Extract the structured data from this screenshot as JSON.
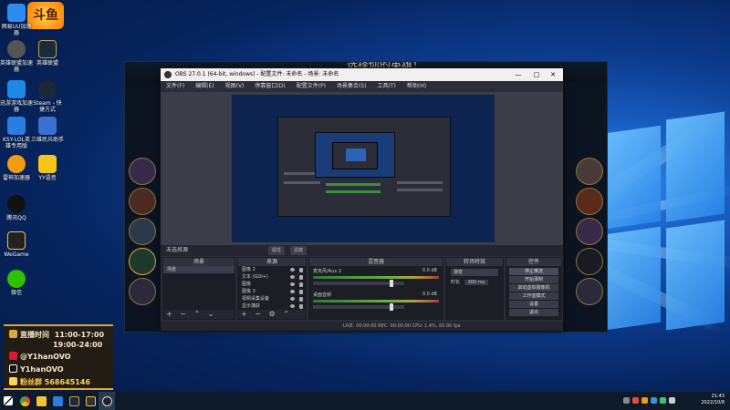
{
  "desktop": {
    "logo_text": "斗鱼",
    "icons": [
      {
        "label": "网易UU加速器"
      },
      {
        "label": "英雄联盟加速器"
      },
      {
        "label": "英雄联盟"
      },
      {
        "label": "迅游游戏加速器"
      },
      {
        "label": "Steam - 快捷方式"
      },
      {
        "label": "KSY-LOL英雄专用版"
      },
      {
        "label": "三维民兵助手"
      },
      {
        "label": "雷神加速器"
      },
      {
        "label": "YY语音"
      },
      {
        "label": "腾讯QQ"
      },
      {
        "label": "WeGame"
      },
      {
        "label": "微信"
      }
    ]
  },
  "game": {
    "title": "选择你的英雄！"
  },
  "obs": {
    "title": "OBS 27.0.1 (64-bit, windows) - 配置文件: 未命名 - 场景: 未命名",
    "window_controls": {
      "minimize": "—",
      "maximize": "□",
      "close": "✕"
    },
    "menu": [
      "文件(F)",
      "编辑(E)",
      "视图(V)",
      "停靠窗口(D)",
      "配置文件(P)",
      "场景集合(S)",
      "工具(T)",
      "帮助(H)"
    ],
    "scene_bar_label": "未选择源",
    "scene_bar_buttons": [
      "属性",
      "滤镜"
    ],
    "docks": {
      "scenes": {
        "title": "场景",
        "items": [
          "场景"
        ],
        "footer": "+ − ⌃ ⌄"
      },
      "sources": {
        "title": "来源",
        "items": [
          "图像 2",
          "文本 (GDI+)",
          "图像",
          "图像 3",
          "视频采集设备",
          "显示捕获"
        ],
        "footer": "+ − ⚙ ⌃ ⌄"
      },
      "mixer": {
        "title": "混音器",
        "tracks": [
          {
            "name": "麦克风/Aux 2",
            "db": "0.0 dB",
            "volume": 0.88
          },
          {
            "name": "桌面音频",
            "db": "0.0 dB",
            "volume": 0.88
          }
        ]
      },
      "transitions": {
        "title": "转场特效",
        "type": "渐变",
        "duration_label": "时长",
        "duration_value": "300 ms"
      },
      "controls": {
        "title": "控件",
        "buttons": [
          "停止推流",
          "开始录制",
          "启动虚拟摄像机",
          "工作室模式",
          "设置",
          "退出"
        ]
      }
    },
    "status": "LIVE: 00:00:00   REC: 00:00:00   CPU: 1.4%, 60.00 fps"
  },
  "overlay": {
    "schedule_title": "直播时间",
    "schedule_1": "11:00-17:00",
    "schedule_2": "19:00-24:00",
    "weibo": "@Y1hanOVO",
    "douyin": "Y1hanOVO",
    "fans_label": "粉丝群",
    "fans_number": "568645146"
  },
  "taskbar": {
    "time": "21:43",
    "date": "2022/10/8"
  }
}
